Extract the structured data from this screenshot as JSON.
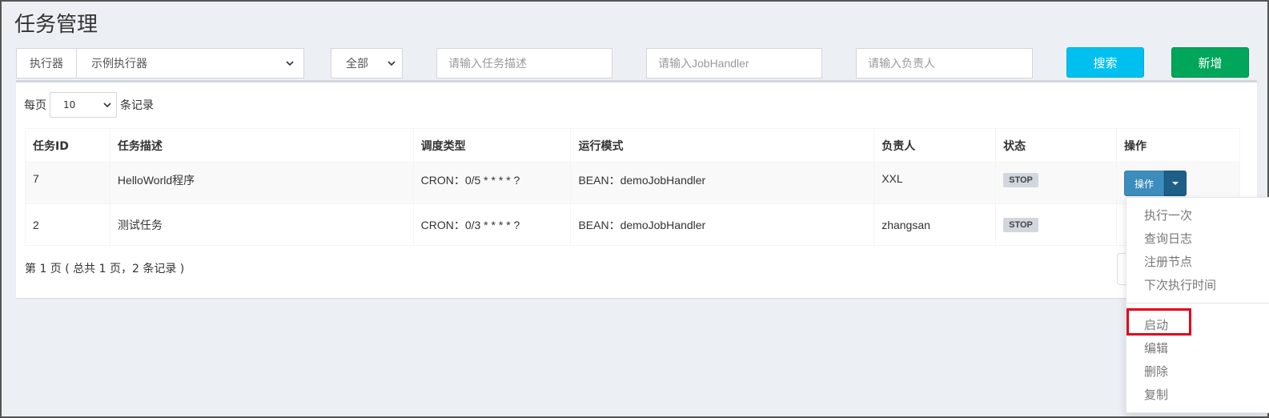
{
  "page": {
    "title": "任务管理"
  },
  "filters": {
    "executor_label": "执行器",
    "executor_value": "示例执行器",
    "status_value": "全部",
    "job_desc_placeholder": "请输入任务描述",
    "handler_placeholder": "请输入JobHandler",
    "author_placeholder": "请输入负责人",
    "search_label": "搜索",
    "add_label": "新增"
  },
  "table_controls": {
    "per_page_prefix": "每页",
    "per_page_value": "10",
    "per_page_suffix": "条记录"
  },
  "table": {
    "headers": [
      "任务ID",
      "任务描述",
      "调度类型",
      "运行模式",
      "负责人",
      "状态",
      "操作"
    ],
    "rows": [
      {
        "id": "7",
        "desc": "HelloWorld程序",
        "schedule": "CRON：0/5 * * * * ?",
        "mode": "BEAN：demoJobHandler",
        "author": "XXL",
        "status": "STOP",
        "op_label": "操作"
      },
      {
        "id": "2",
        "desc": "测试任务",
        "schedule": "CRON：0/3 * * * * ?",
        "mode": "BEAN：demoJobHandler",
        "author": "zhangsan",
        "status": "STOP"
      }
    ]
  },
  "pagination": {
    "info": "第 1 页 ( 总共 1 页，2 条记录 )"
  },
  "dropdown_menu": {
    "items": [
      "执行一次",
      "查询日志",
      "注册节点",
      "下次执行时间",
      "启动",
      "编辑",
      "删除",
      "复制"
    ]
  },
  "colors": {
    "search_button": "#00c0ef",
    "add_button": "#00a65a",
    "op_button": "#3c8dbc",
    "highlight_border": "#e3001b"
  },
  "icons": {
    "select_arrow": "chevron-down-icon",
    "dropdown_caret": "caret-down-icon"
  }
}
